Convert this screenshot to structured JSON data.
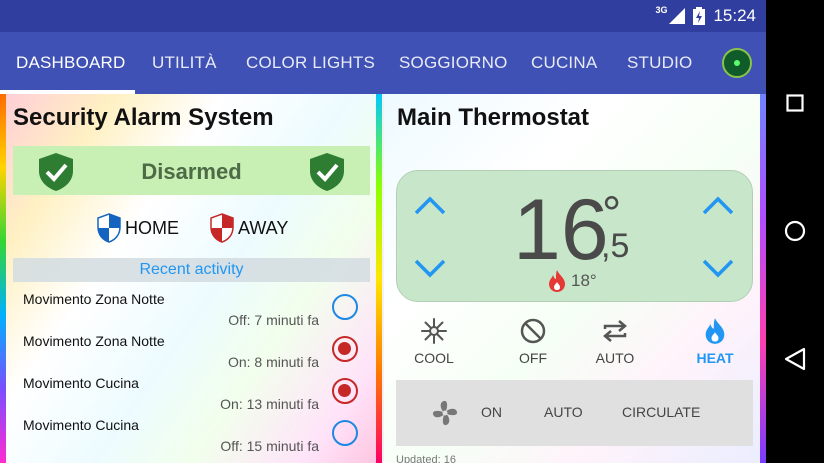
{
  "status_bar": {
    "time": "15:24",
    "network": "3G",
    "icons": [
      "signal-icon",
      "battery-charging-icon"
    ]
  },
  "tabs": [
    {
      "label": "DASHBOARD",
      "active": true
    },
    {
      "label": "UTILITÀ",
      "active": false
    },
    {
      "label": "COLOR LIGHTS",
      "active": false
    },
    {
      "label": "SOGGIORNO",
      "active": false
    },
    {
      "label": "CUCINA",
      "active": false
    },
    {
      "label": "STUDIO",
      "active": false
    }
  ],
  "nav_bar": {
    "icons": [
      "recents-icon",
      "home-icon",
      "back-icon"
    ]
  },
  "alarm": {
    "title": "Security Alarm System",
    "status": "Disarmed",
    "home_label": "HOME",
    "away_label": "AWAY",
    "recent_header": "Recent activity",
    "activities": [
      {
        "name": "Movimento Zona Notte",
        "time": "Off: 7 minuti fa",
        "active": false
      },
      {
        "name": "Movimento Zona Notte",
        "time": "On: 8 minuti fa",
        "active": true
      },
      {
        "name": "Movimento Cucina",
        "time": "On: 13 minuti fa",
        "active": true
      },
      {
        "name": "Movimento Cucina",
        "time": "Off: 15 minuti fa",
        "active": false
      }
    ]
  },
  "thermostat": {
    "title": "Main Thermostat",
    "temp_whole": "16",
    "temp_degree": "°",
    "temp_decimal": ",5",
    "target": "18°",
    "modes": [
      {
        "label": "COOL",
        "icon": "snowflake-icon",
        "active": false
      },
      {
        "label": "OFF",
        "icon": "off-icon",
        "active": false
      },
      {
        "label": "AUTO",
        "icon": "auto-repeat-icon",
        "active": false
      },
      {
        "label": "HEAT",
        "icon": "flame-icon",
        "active": true
      }
    ],
    "fan": {
      "icon": "fan-icon",
      "options": [
        "ON",
        "AUTO",
        "CIRCULATE"
      ]
    },
    "bottom_peek": "Updated: 16"
  },
  "colors": {
    "primary": "#3f51b5",
    "primary_dark": "#303f9f",
    "accent_blue": "#2196f3",
    "heat_red": "#e53935",
    "shield_green": "#2e7d32",
    "shield_blue": "#1565c0",
    "shield_red": "#c62828"
  }
}
